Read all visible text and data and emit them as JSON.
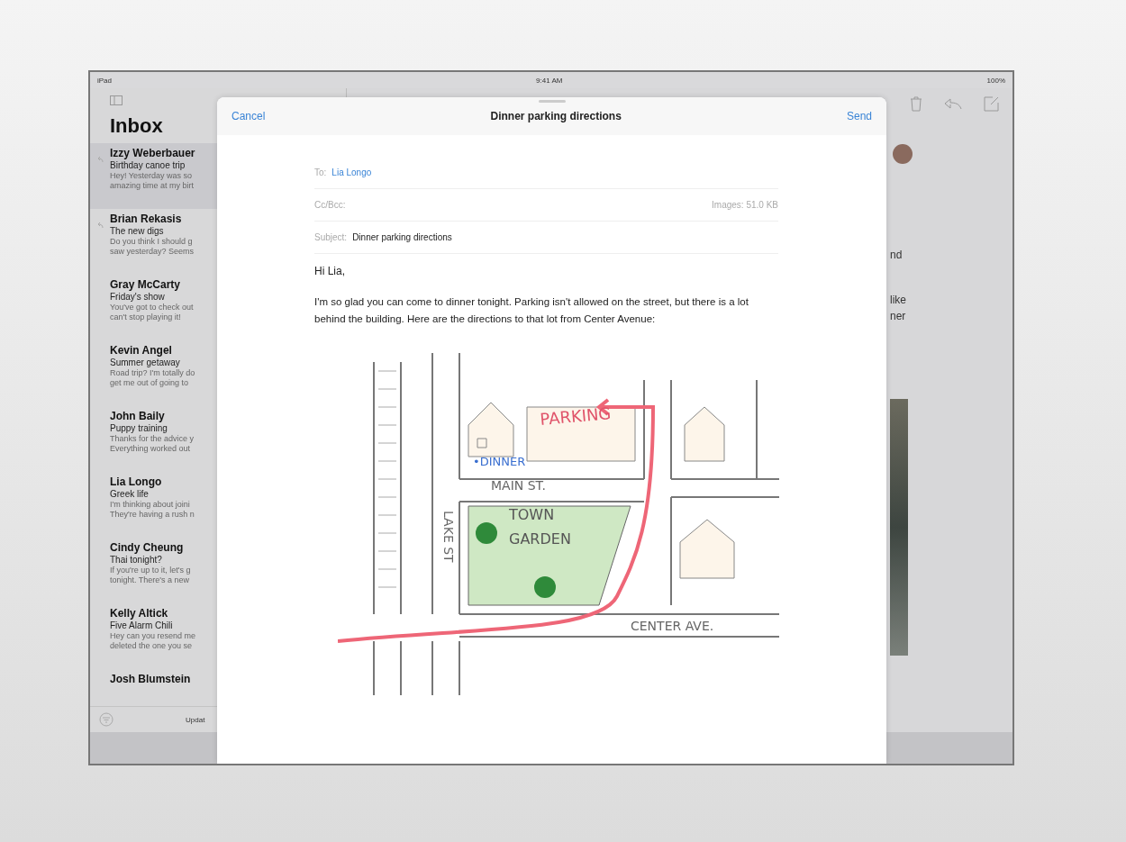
{
  "status_bar": {
    "device": "iPad",
    "time": "9:41 AM",
    "battery": "100%"
  },
  "sidebar": {
    "title": "Inbox",
    "messages": [
      {
        "sender": "Izzy Weberbauer",
        "subject": "Birthday canoe trip",
        "preview": [
          "Hey! Yesterday was so",
          "amazing time at my birt"
        ],
        "selected": true,
        "replied": true
      },
      {
        "sender": "Brian Rekasis",
        "subject": "The new digs",
        "preview": [
          "Do you think I should g",
          "saw yesterday? Seems"
        ],
        "selected": false,
        "replied": true
      },
      {
        "sender": "Gray McCarty",
        "subject": "Friday's show",
        "preview": [
          "You've got to check out",
          "can't stop playing it!"
        ],
        "selected": false,
        "replied": false
      },
      {
        "sender": "Kevin Angel",
        "subject": "Summer getaway",
        "preview": [
          "Road trip? I'm totally do",
          "get me out of going to"
        ],
        "selected": false,
        "replied": false
      },
      {
        "sender": "John Baily",
        "subject": "Puppy training",
        "preview": [
          "Thanks for the advice y",
          "Everything worked out"
        ],
        "selected": false,
        "replied": false
      },
      {
        "sender": "Lia Longo",
        "subject": "Greek life",
        "preview": [
          "I'm thinking about joini",
          "They're having a rush n"
        ],
        "selected": false,
        "replied": false
      },
      {
        "sender": "Cindy Cheung",
        "subject": "Thai tonight?",
        "preview": [
          "If you're up to it, let's g",
          "tonight. There's a new"
        ],
        "selected": false,
        "replied": false
      },
      {
        "sender": "Kelly Altick",
        "subject": "Five Alarm Chili",
        "preview": [
          "Hey can you resend me",
          "deleted the one you se"
        ],
        "selected": false,
        "replied": false
      },
      {
        "sender": "Josh Blumstein",
        "selected": false,
        "replied": false
      }
    ],
    "footer": "Updat"
  },
  "detail": {
    "fragments": [
      "nd",
      "like",
      "ner"
    ]
  },
  "compose": {
    "cancel": "Cancel",
    "title": "Dinner parking directions",
    "send": "Send",
    "to_label": "To:",
    "to": "Lia Longo",
    "cc_label": "Cc/Bcc:",
    "images": "Images: 51.0 KB",
    "subject_label": "Subject:",
    "subject": "Dinner parking directions",
    "greeting": "Hi Lia,",
    "body": "I'm so glad you can come to dinner tonight. Parking isn't allowed on the street, but there is a lot behind the building. Here are the directions to that lot from Center Avenue:",
    "map_labels": [
      {
        "text": "PARKING",
        "color": "#e0546a"
      },
      {
        "text": "•DINNER",
        "color": "#3a6fd0"
      },
      {
        "text": "MAIN ST.",
        "color": "#666666"
      },
      {
        "text": "TOWN",
        "color": "#555555"
      },
      {
        "text": "GARDEN",
        "color": "#555555"
      },
      {
        "text": "LAKE ST",
        "color": "#666666"
      },
      {
        "text": "CENTER AVE.",
        "color": "#666666"
      }
    ]
  }
}
